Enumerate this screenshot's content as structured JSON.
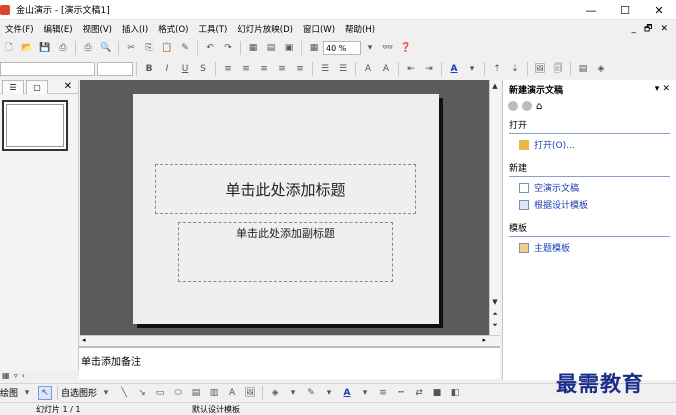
{
  "window": {
    "title": "金山演示 - [演示文稿1]",
    "minimize": "—",
    "maximize": "☐",
    "close": "✕"
  },
  "menu": {
    "items": [
      "文件(F)",
      "编辑(E)",
      "视图(V)",
      "插入(I)",
      "格式(O)",
      "工具(T)",
      "幻灯片放映(D)",
      "窗口(W)",
      "帮助(H)"
    ],
    "doc_controls": [
      "_",
      "🗗",
      "✕"
    ]
  },
  "toolbar1": {
    "zoom": "40 %"
  },
  "left_panel": {
    "close": "✕"
  },
  "slide": {
    "title_placeholder": "单击此处添加标题",
    "subtitle_placeholder": "单击此处添加副标题"
  },
  "notes": {
    "placeholder": "单击添加备注"
  },
  "taskpane": {
    "title": "新建演示文稿",
    "open_section": "打开",
    "open_link": "打开(O)...",
    "new_section": "新建",
    "new_links": [
      "空演示文稿",
      "根据设计模板"
    ],
    "template_section": "模板",
    "template_link": "主题模板"
  },
  "drawbar": {
    "draw_label": "绘图",
    "autoshape_label": "自选图形"
  },
  "status": {
    "slide_counter": "幻灯片 1 / 1",
    "design": "默认设计模板"
  },
  "watermark": "最需教育"
}
